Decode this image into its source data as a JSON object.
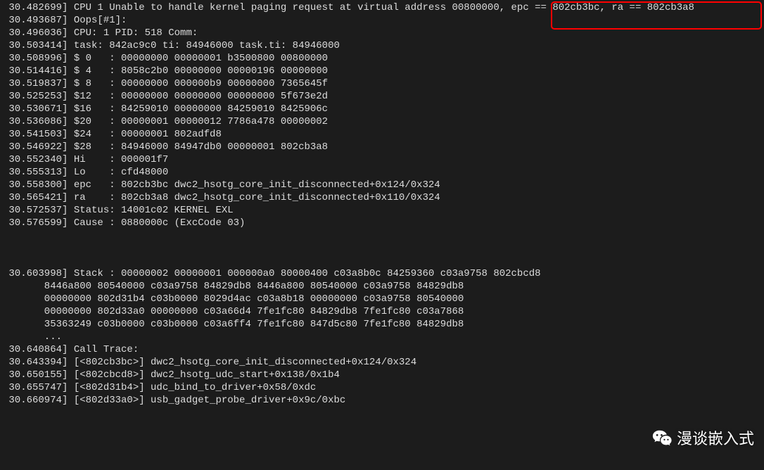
{
  "highlighted_info": {
    "epc": "802cb3bc",
    "ra": "802cb3a8"
  },
  "log_lines": [
    " 30.482699] CPU 1 Unable to handle kernel paging request at virtual address 00800000, epc == 802cb3bc, ra == 802cb3a8",
    " 30.493687] Oops[#1]:",
    " 30.496036] CPU: 1 PID: 518 Comm:",
    " 30.503414] task: 842ac9c0 ti: 84946000 task.ti: 84946000",
    " 30.508996] $ 0   : 00000000 00000001 b3500800 00800000",
    " 30.514416] $ 4   : 8058c2b0 00000000 00000196 00000000",
    " 30.519837] $ 8   : 00000000 000000b9 00000000 7365645f",
    " 30.525253] $12   : 00000000 00000000 00000000 5f673e2d",
    " 30.530671] $16   : 84259010 00000000 84259010 8425906c",
    " 30.536086] $20   : 00000001 00000012 7786a478 00000002",
    " 30.541503] $24   : 00000001 802adfd8",
    " 30.546922] $28   : 84946000 84947db0 00000001 802cb3a8",
    " 30.552340] Hi    : 000001f7",
    " 30.555313] Lo    : cfd48000",
    " 30.558300] epc   : 802cb3bc dwc2_hsotg_core_init_disconnected+0x124/0x324",
    " 30.565421] ra    : 802cb3a8 dwc2_hsotg_core_init_disconnected+0x110/0x324",
    " 30.572537] Status: 14001c02 KERNEL EXL",
    " 30.576599] Cause : 0880000c (ExcCode 03)",
    "",
    "",
    "",
    " 30.603998] Stack : 00000002 00000001 000000a0 80000400 c03a8b0c 84259360 c03a9758 802cbcd8",
    "       8446a800 80540000 c03a9758 84829db8 8446a800 80540000 c03a9758 84829db8",
    "       00000000 802d31b4 c03b0000 8029d4ac c03a8b18 00000000 c03a9758 80540000",
    "       00000000 802d33a0 00000000 c03a66d4 7fe1fc80 84829db8 7fe1fc80 c03a7868",
    "       35363249 c03b0000 c03b0000 c03a6ff4 7fe1fc80 847d5c80 7fe1fc80 84829db8",
    "       ...",
    " 30.640864] Call Trace:",
    " 30.643394] [<802cb3bc>] dwc2_hsotg_core_init_disconnected+0x124/0x324",
    " 30.650155] [<802cbcd8>] dwc2_hsotg_udc_start+0x138/0x1b4",
    " 30.655747] [<802d31b4>] udc_bind_to_driver+0x58/0xdc",
    " 30.660974] [<802d33a0>] usb_gadget_probe_driver+0x9c/0xbc"
  ],
  "watermark": {
    "label": "漫谈嵌入式"
  }
}
